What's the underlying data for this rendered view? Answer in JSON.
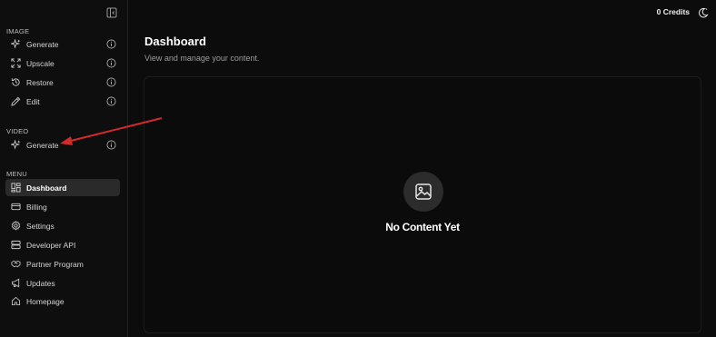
{
  "sidebar": {
    "image_section": {
      "label": "IMAGE",
      "items": [
        {
          "label": "Generate"
        },
        {
          "label": "Upscale"
        },
        {
          "label": "Restore"
        },
        {
          "label": "Edit"
        }
      ]
    },
    "video_section": {
      "label": "VIDEO",
      "items": [
        {
          "label": "Generate"
        }
      ]
    },
    "menu_section": {
      "label": "MENU",
      "items": [
        {
          "label": "Dashboard",
          "active": true
        },
        {
          "label": "Billing"
        },
        {
          "label": "Settings"
        },
        {
          "label": "Developer API"
        },
        {
          "label": "Partner Program"
        },
        {
          "label": "Updates"
        },
        {
          "label": "Homepage"
        }
      ]
    }
  },
  "header": {
    "credits": "0 Credits"
  },
  "main": {
    "title": "Dashboard",
    "subtitle": "View and manage your content.",
    "empty_state": "No Content Yet"
  },
  "colors": {
    "background": "#0c0c0c",
    "active_item": "#2a2a2a",
    "annotation_arrow": "#d42a2a"
  }
}
